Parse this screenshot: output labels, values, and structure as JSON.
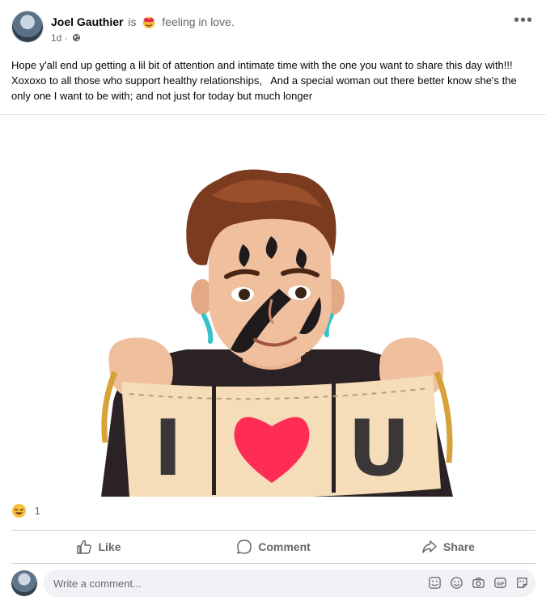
{
  "post": {
    "author": "Joel Gauthier",
    "is_word": "is",
    "feeling_text": "feeling in love.",
    "timestamp": "1d",
    "separator": "·",
    "audience_icon": "globe-icon",
    "more_label": "•••",
    "text": "Hope y'all end up getting a lil bit of attention and intimate time with the one you want to share this day with!!!   Xoxoxo to all those who support healthy relationships,   And a special woman out there better know she's the only one I want to be with; and not just for today but much longer"
  },
  "image": {
    "banner_letters": [
      "I",
      "U"
    ],
    "accent_heart": "#ff2d55"
  },
  "reactions": {
    "icon": "haha-face-icon",
    "count": "1"
  },
  "actions": {
    "like": "Like",
    "comment": "Comment",
    "share": "Share"
  },
  "comment_box": {
    "placeholder": "Write a comment...",
    "icons": [
      "sticker-icon",
      "emoji-icon",
      "camera-icon",
      "gif-icon",
      "sticker-face-icon"
    ]
  },
  "colors": {
    "secondary_text": "#65676b",
    "input_bg": "#f0f2f5",
    "divider": "#ced0d4"
  }
}
